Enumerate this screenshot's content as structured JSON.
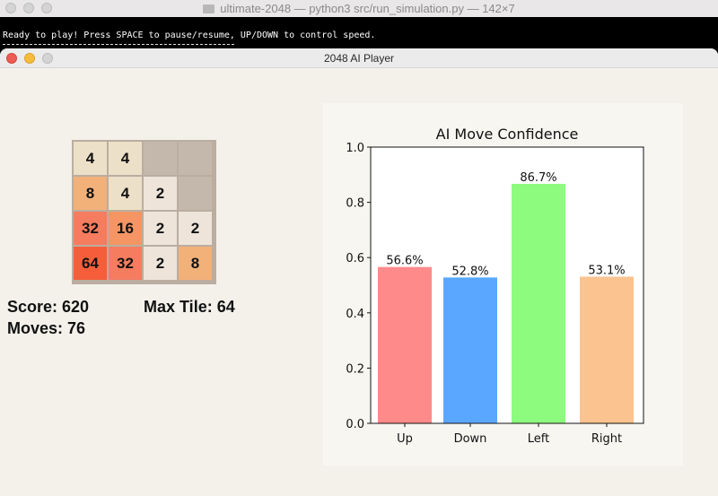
{
  "terminal": {
    "title": "ultimate-2048 — python3 src/run_simulation.py — 142×7",
    "line1": "Ready to play! Press SPACE to pause/resume, UP/DOWN to control speed."
  },
  "app": {
    "title": "2048 AI Player"
  },
  "board": {
    "rows": [
      [
        "4",
        "4",
        "",
        ""
      ],
      [
        "8",
        "4",
        "2",
        ""
      ],
      [
        "32",
        "16",
        "2",
        "2"
      ],
      [
        "64",
        "32",
        "2",
        "8"
      ]
    ],
    "colors": {
      "": "#c4b8ac",
      "2": "#eee4da",
      "4": "#ede0c8",
      "8": "#f2b179",
      "16": "#f59563",
      "32": "#f67c5f",
      "64": "#f65e3b"
    }
  },
  "stats": {
    "score": "Score: 620",
    "max_tile": "Max Tile: 64",
    "moves": "Moves: 76"
  },
  "chart_data": {
    "type": "bar",
    "title": "AI Move Confidence",
    "categories": [
      "Up",
      "Down",
      "Left",
      "Right"
    ],
    "values": [
      0.566,
      0.528,
      0.867,
      0.531
    ],
    "data_labels": [
      "56.6%",
      "52.8%",
      "86.7%",
      "53.1%"
    ],
    "colors": [
      "#ff8a8a",
      "#5aa7ff",
      "#8cfb7e",
      "#fbc38f"
    ],
    "ylim": [
      0,
      1.0
    ],
    "yticks": [
      "0.0",
      "0.2",
      "0.4",
      "0.6",
      "0.8",
      "1.0"
    ],
    "xlabel": "",
    "ylabel": "",
    "grid": false,
    "legend": "none"
  }
}
